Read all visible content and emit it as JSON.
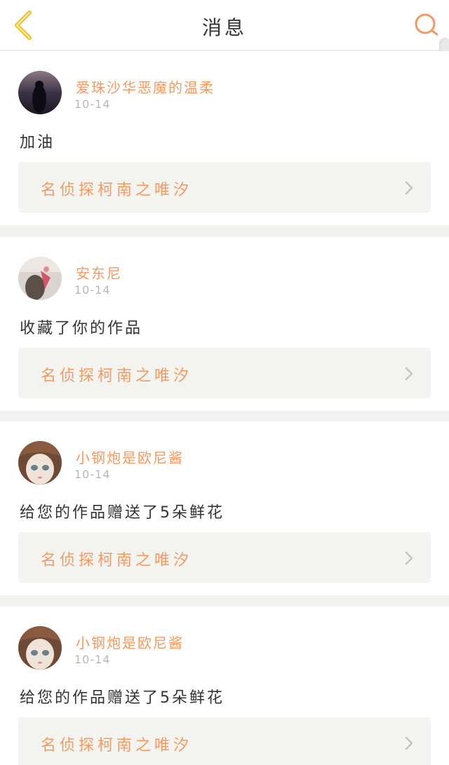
{
  "header": {
    "title": "消息",
    "icons": {
      "back": "chevron-left-icon",
      "search": "search-icon"
    },
    "accent_color": "#f29a63",
    "back_color": "#e8c23a"
  },
  "messages": [
    {
      "user": "爱珠沙华恶魔的温柔",
      "time": "10-14",
      "content": "加油",
      "work": "名侦探柯南之唯汐",
      "avatar": "dark-night-avatar"
    },
    {
      "user": "安东尼",
      "time": "10-14",
      "content": "收藏了你的作品",
      "work": "名侦探柯南之唯汐",
      "avatar": "pink-scarf-avatar"
    },
    {
      "user": "小钢炮是欧尼酱",
      "time": "10-14",
      "content": "给您的作品赠送了5朵鲜花",
      "work": "名侦探柯南之唯汐",
      "avatar": "doll-face-avatar"
    },
    {
      "user": "小钢炮是欧尼酱",
      "time": "10-14",
      "content": "给您的作品赠送了5朵鲜花",
      "work": "名侦探柯南之唯汐",
      "avatar": "doll-face-avatar"
    }
  ]
}
